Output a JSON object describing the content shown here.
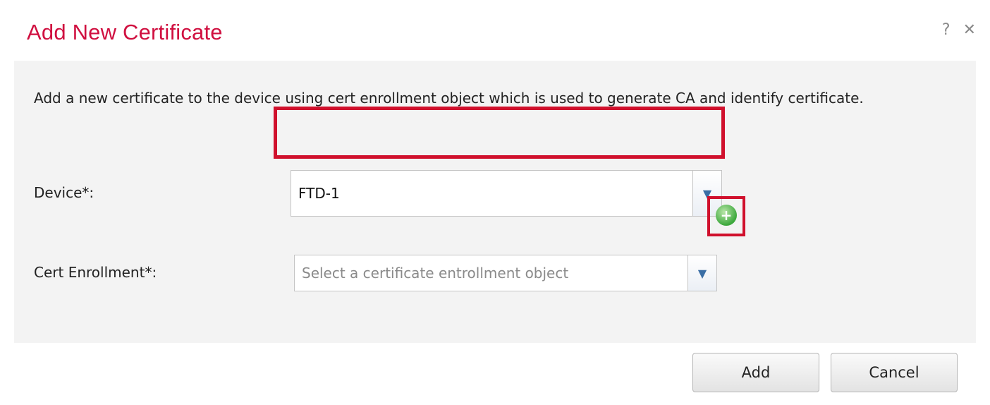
{
  "dialog": {
    "title": "Add New Certificate",
    "help_icon": "?",
    "close_icon": "✕"
  },
  "body": {
    "description": "Add a new certificate to the device using cert enrollment object which is used to generate CA and identify certificate.",
    "device": {
      "label": "Device*:",
      "value": "FTD-1"
    },
    "cert_enrollment": {
      "label": "Cert Enrollment*:",
      "placeholder": "Select a certificate entrollment object",
      "add_icon": "+"
    }
  },
  "footer": {
    "add_label": "Add",
    "cancel_label": "Cancel"
  },
  "colors": {
    "title": "#d01040",
    "highlight": "#d0102c",
    "panel": "#f3f3f3",
    "add_icon": "#3da83c"
  }
}
